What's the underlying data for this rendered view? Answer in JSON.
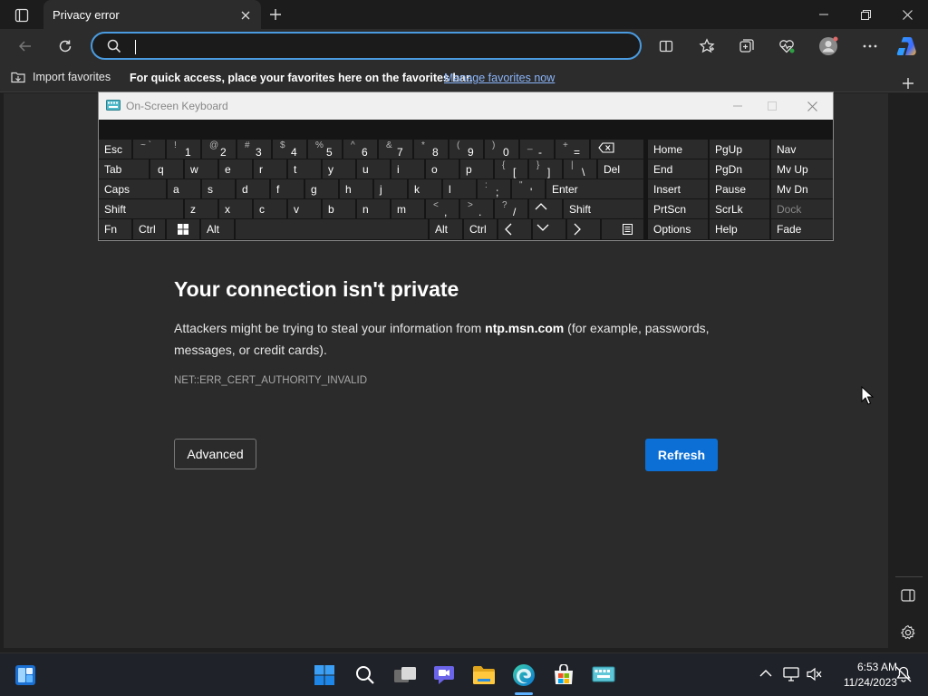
{
  "tab": {
    "title": "Privacy error"
  },
  "address": {
    "value": "",
    "placeholder": ""
  },
  "favorites_bar": {
    "import_label": "Import favorites",
    "hint": "For quick access, place your favorites here on the favorites bar.",
    "manage_link": "Manage favorites now"
  },
  "error": {
    "title": "Your connection isn't private",
    "body_before": "Attackers might be trying to steal your information from ",
    "host": "ntp.msn.com",
    "body_after": " (for example, passwords, messages, or credit cards).",
    "code": "NET::ERR_CERT_AUTHORITY_INVALID",
    "advanced_label": "Advanced",
    "refresh_label": "Refresh"
  },
  "osk": {
    "title": "On-Screen Keyboard",
    "row1": {
      "esc": "Esc",
      "pairs": [
        [
          "~ `",
          ""
        ],
        [
          "!",
          "1"
        ],
        [
          "@",
          "2"
        ],
        [
          "#",
          "3"
        ],
        [
          "$",
          "4"
        ],
        [
          "%",
          "5"
        ],
        [
          "^",
          "6"
        ],
        [
          "&",
          "7"
        ],
        [
          "*",
          "8"
        ],
        [
          "(",
          "9"
        ],
        [
          ")",
          "0"
        ],
        [
          "_",
          "-"
        ],
        [
          "+",
          "="
        ]
      ]
    },
    "row2": {
      "tab": "Tab",
      "letters": [
        "q",
        "w",
        "e",
        "r",
        "t",
        "y",
        "u",
        "i",
        "o",
        "p"
      ],
      "brackets": [
        [
          "{",
          "["
        ],
        [
          "}",
          "]"
        ],
        [
          "|",
          "\\"
        ]
      ],
      "del": "Del"
    },
    "row3": {
      "caps": "Caps",
      "letters": [
        "a",
        "s",
        "d",
        "f",
        "g",
        "h",
        "j",
        "k",
        "l"
      ],
      "punct": [
        [
          ":",
          ";"
        ],
        [
          "\"",
          "'"
        ]
      ],
      "enter": "Enter"
    },
    "row4": {
      "shift_left": "Shift",
      "letters": [
        "z",
        "x",
        "c",
        "v",
        "b",
        "n",
        "m"
      ],
      "punct": [
        [
          "<",
          ","
        ],
        [
          ">",
          "."
        ],
        [
          "?",
          "/"
        ]
      ],
      "shift_right": "Shift"
    },
    "row5": {
      "fn": "Fn",
      "ctrl_left": "Ctrl",
      "alt_left": "Alt",
      "alt_right": "Alt",
      "ctrl_right": "Ctrl"
    },
    "nav": [
      [
        "Home",
        "PgUp",
        "Nav"
      ],
      [
        "End",
        "PgDn",
        "Mv Up"
      ],
      [
        "Insert",
        "Pause",
        "Mv Dn"
      ],
      [
        "PrtScn",
        "ScrLk",
        "Dock"
      ],
      [
        "Options",
        "Help",
        "Fade"
      ]
    ]
  },
  "clock": {
    "time": "6:53 AM",
    "date": "11/24/2023"
  },
  "colors": {
    "accent": "#0b6fd6",
    "link": "#8ab4f8",
    "focus": "#4a9be0"
  }
}
